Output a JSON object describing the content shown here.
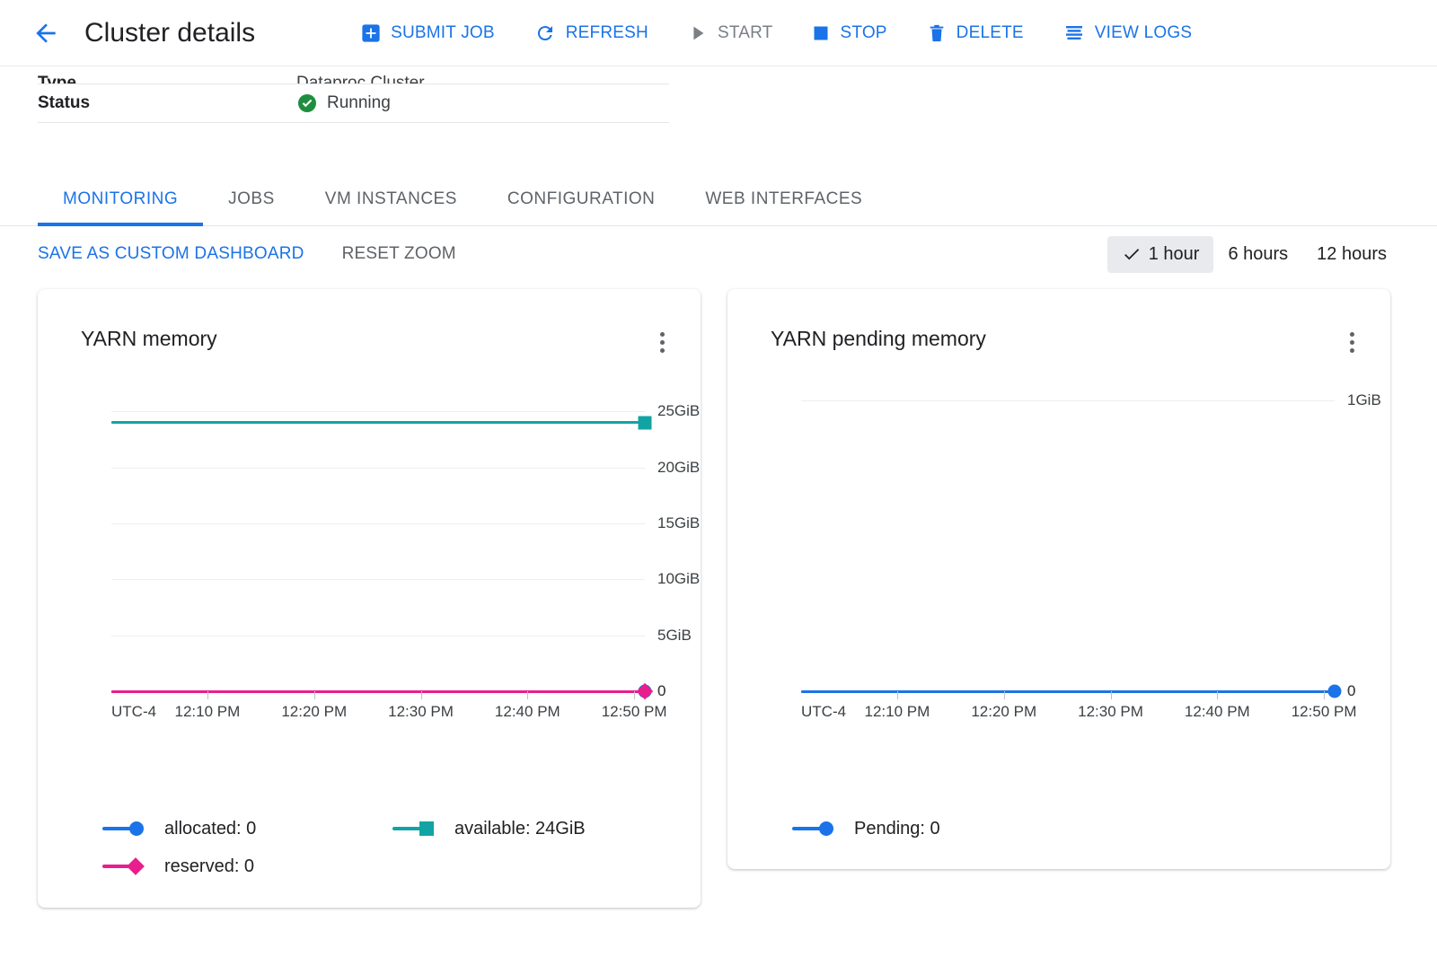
{
  "header": {
    "back_icon": "arrow-left-icon",
    "title": "Cluster details",
    "actions": [
      {
        "label": "SUBMIT JOB",
        "icon": "plus-box-icon",
        "disabled": false
      },
      {
        "label": "REFRESH",
        "icon": "refresh-icon",
        "disabled": false
      },
      {
        "label": "START",
        "icon": "play-icon",
        "disabled": true
      },
      {
        "label": "STOP",
        "icon": "stop-square-icon",
        "disabled": false
      },
      {
        "label": "DELETE",
        "icon": "trash-icon",
        "disabled": false
      },
      {
        "label": "VIEW LOGS",
        "icon": "logs-lines-icon",
        "disabled": false
      }
    ]
  },
  "details": {
    "rows": [
      {
        "label": "Type",
        "value": "Dataproc Cluster",
        "icon": ""
      },
      {
        "label": "Status",
        "value": "Running",
        "icon": "check-circle-icon"
      }
    ]
  },
  "tabs": [
    {
      "label": "MONITORING",
      "active": true
    },
    {
      "label": "JOBS",
      "active": false
    },
    {
      "label": "VM INSTANCES",
      "active": false
    },
    {
      "label": "CONFIGURATION",
      "active": false
    },
    {
      "label": "WEB INTERFACES",
      "active": false
    }
  ],
  "toolbar": {
    "save_dashboard_label": "SAVE AS CUSTOM DASHBOARD",
    "reset_zoom_label": "RESET ZOOM",
    "ranges": [
      {
        "label": "1 hour",
        "selected": true,
        "check_icon": "check-icon"
      },
      {
        "label": "6 hours",
        "selected": false,
        "check_icon": ""
      },
      {
        "label": "12 hours",
        "selected": false,
        "check_icon": ""
      }
    ]
  },
  "colors": {
    "accent_blue": "#1a73e8",
    "series_allocated": "#1a73e8",
    "series_available": "#12a4a4",
    "series_reserved": "#e91e8c",
    "series_pending": "#1a73e8",
    "status_green": "#1e8e3e",
    "gridline": "#eceeef",
    "text_primary": "#202124",
    "text_secondary": "#5f6368"
  },
  "cards": [
    {
      "title": "YARN memory",
      "menu_icon": "kebab-menu-icon",
      "legend": [
        {
          "name": "allocated",
          "value": "0",
          "label": "allocated: 0",
          "color": "#1a73e8",
          "marker": "circle"
        },
        {
          "name": "available",
          "value": "24GiB",
          "label": "available: 24GiB",
          "color": "#12a4a4",
          "marker": "square"
        },
        {
          "name": "reserved",
          "value": "0",
          "label": "reserved: 0",
          "color": "#e91e8c",
          "marker": "diamond"
        }
      ]
    },
    {
      "title": "YARN pending memory",
      "menu_icon": "kebab-menu-icon",
      "legend": [
        {
          "name": "Pending",
          "value": "0",
          "label": "Pending: 0",
          "color": "#1a73e8",
          "marker": "circle"
        }
      ]
    }
  ],
  "chart_data": [
    {
      "type": "line",
      "title": "YARN memory",
      "xlabel": "",
      "ylabel": "",
      "timezone_label": "UTC-4",
      "xticks": [
        "12:10 PM",
        "12:20 PM",
        "12:30 PM",
        "12:40 PM",
        "12:50 PM"
      ],
      "yticks": [
        "0",
        "5GiB",
        "10GiB",
        "15GiB",
        "20GiB",
        "25GiB"
      ],
      "ytick_values": [
        0,
        5,
        10,
        15,
        20,
        25
      ],
      "ylim": [
        0,
        26
      ],
      "yunit": "GiB",
      "grid": true,
      "legend_position": "bottom",
      "series": [
        {
          "name": "allocated",
          "color": "#1a73e8",
          "marker": "circle",
          "value": 0,
          "value_label": "0",
          "constant": true
        },
        {
          "name": "available",
          "color": "#12a4a4",
          "marker": "square",
          "value": 24,
          "value_label": "24GiB",
          "constant": true
        },
        {
          "name": "reserved",
          "color": "#e91e8c",
          "marker": "diamond",
          "value": 0,
          "value_label": "0",
          "constant": true
        }
      ],
      "endpoint_labels": [
        {
          "series": "available",
          "text": ""
        },
        {
          "series": "reserved",
          "text": "0"
        }
      ]
    },
    {
      "type": "line",
      "title": "YARN pending memory",
      "xlabel": "",
      "ylabel": "",
      "timezone_label": "UTC-4",
      "xticks": [
        "12:10 PM",
        "12:20 PM",
        "12:30 PM",
        "12:40 PM",
        "12:50 PM"
      ],
      "yticks": [
        "0",
        "1GiB"
      ],
      "ytick_values": [
        0,
        1
      ],
      "ylim": [
        0,
        1
      ],
      "yunit": "GiB",
      "grid": true,
      "legend_position": "bottom",
      "series": [
        {
          "name": "Pending",
          "color": "#1a73e8",
          "marker": "circle",
          "value": 0,
          "value_label": "0",
          "constant": true
        }
      ],
      "endpoint_labels": [
        {
          "series": "Pending",
          "text": "0"
        }
      ]
    }
  ]
}
